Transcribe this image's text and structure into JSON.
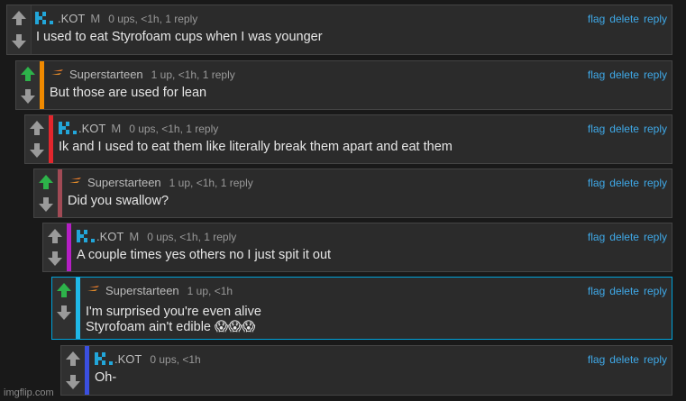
{
  "actions": {
    "flag": "flag",
    "delete": "delete",
    "reply": "reply"
  },
  "comments": [
    {
      "user": ".KOT",
      "tag": "M",
      "meta": "0 ups, <1h, 1 reply",
      "text": "I used to eat Styrofoam cups when I was younger",
      "avatar": "kot-avatar",
      "bar_color": "",
      "up_color": "#9a9a9a"
    },
    {
      "user": "Superstarteen",
      "tag": "",
      "meta": "1 up, <1h, 1 reply",
      "text": "But those are used for lean",
      "avatar": "superstarteen-avatar",
      "bar_color": "#f08a00",
      "up_color": "#2db34a"
    },
    {
      "user": ".KOT",
      "tag": "M",
      "meta": "0 ups, <1h, 1 reply",
      "text": "Ik and I used to eat them like literally break them apart and eat them",
      "avatar": "kot-avatar",
      "bar_color": "#e2262d",
      "up_color": "#9a9a9a"
    },
    {
      "user": "Superstarteen",
      "tag": "",
      "meta": "1 up, <1h, 1 reply",
      "text": "Did you swallow?",
      "avatar": "superstarteen-avatar",
      "bar_color": "#a14a55",
      "up_color": "#2db34a"
    },
    {
      "user": ".KOT",
      "tag": "M",
      "meta": "0 ups, <1h, 1 reply",
      "text": "A couple times yes others no I just spit it out",
      "avatar": "kot-avatar",
      "bar_color": "#b51fc4",
      "up_color": "#9a9a9a"
    },
    {
      "user": "Superstarteen",
      "tag": "",
      "meta": "1 up, <1h",
      "text_line1": "I'm surprised you're even alive",
      "text_line2": "Styrofoam ain't edible 😱😱😱",
      "avatar": "superstarteen-avatar",
      "bar_color": "#1fb8e8",
      "up_color": "#2db34a"
    },
    {
      "user": ".KOT",
      "tag": "",
      "meta": "0 ups, <1h",
      "text": "Oh-",
      "avatar": "kot-avatar",
      "bar_color": "#3a4fe0",
      "up_color": "#9a9a9a"
    }
  ],
  "watermark": "imgflip.com"
}
